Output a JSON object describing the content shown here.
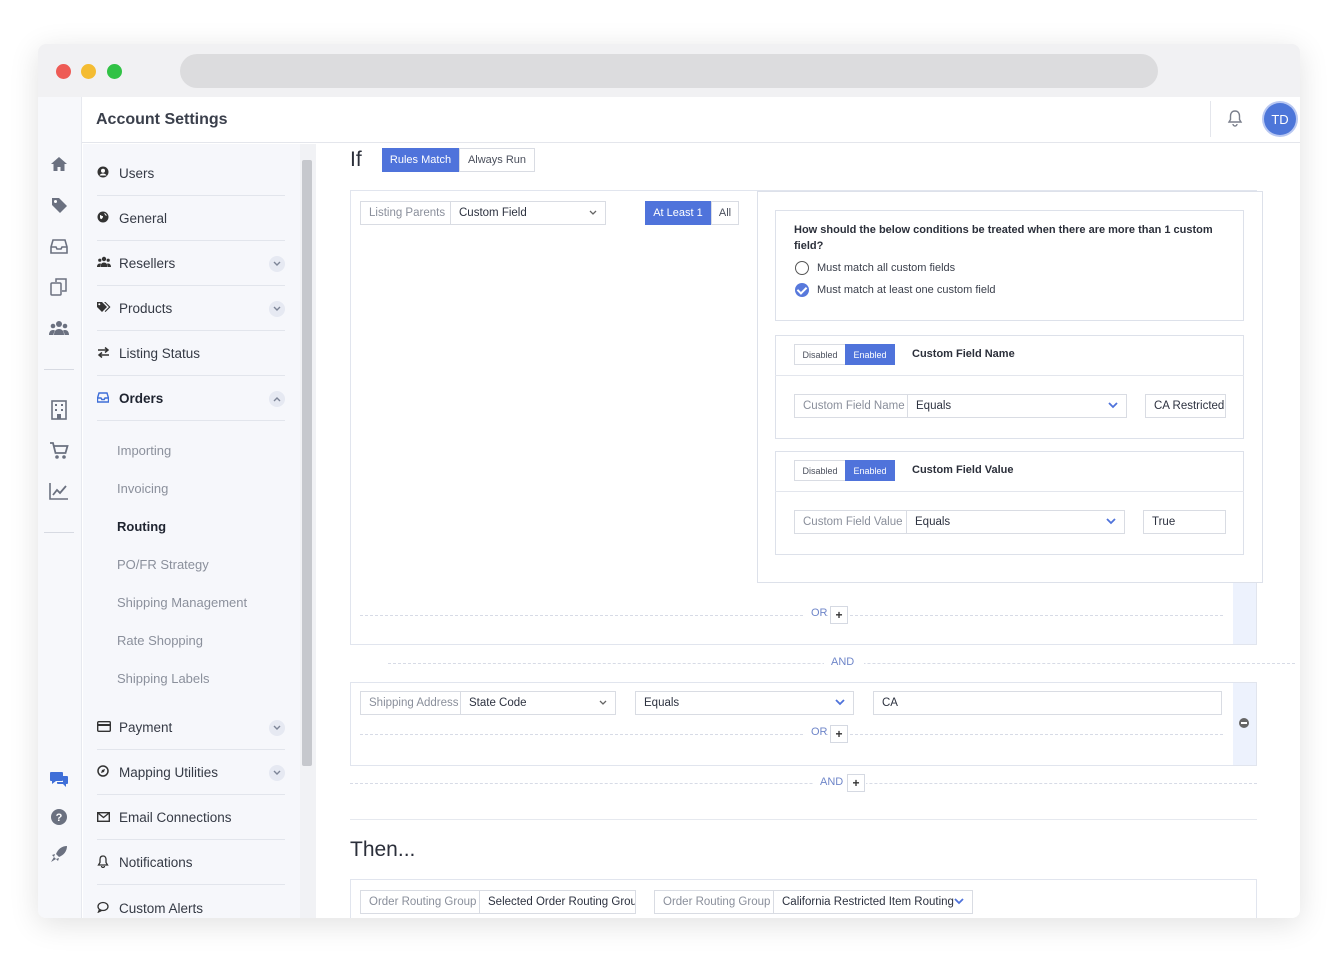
{
  "app": {
    "title": "Account Settings",
    "avatar_initials": "TD",
    "accent": "#4f73db"
  },
  "rail": {
    "icons": [
      "home-icon",
      "tag-icon",
      "inbox-icon",
      "copy-icon",
      "users-icon",
      "building-icon",
      "cart-icon",
      "chart-icon",
      "chat-icon",
      "help-icon",
      "rocket-icon",
      "gear-icon"
    ]
  },
  "nav": {
    "items": [
      {
        "label": "Users"
      },
      {
        "label": "General"
      },
      {
        "label": "Resellers"
      },
      {
        "label": "Products"
      },
      {
        "label": "Listing Status"
      },
      {
        "label": "Orders"
      },
      {
        "label": "Payment"
      },
      {
        "label": "Mapping Utilities"
      },
      {
        "label": "Email Connections"
      },
      {
        "label": "Notifications"
      },
      {
        "label": "Custom Alerts"
      }
    ],
    "orders_sub": [
      "Importing",
      "Invoicing",
      "Routing",
      "PO/FR Strategy",
      "Shipping Management",
      "Rate Shopping",
      "Shipping Labels"
    ]
  },
  "rule": {
    "if_label": "If",
    "mode_on": "Rules Match",
    "mode_off": "Always Run",
    "cond1": {
      "label": "Listing Parents",
      "field": "Custom Field",
      "match_on": "At Least 1",
      "match_off": "All"
    },
    "custom": {
      "question": "How should the below conditions be treated when there are more than 1 custom field?",
      "opt_all": "Must match all custom fields",
      "opt_one": "Must match at least one custom field",
      "name_block": {
        "disabled": "Disabled",
        "enabled": "Enabled",
        "title": "Custom Field Name",
        "label": "Custom Field Name",
        "op": "Equals",
        "value": "CA Restricted"
      },
      "value_block": {
        "disabled": "Disabled",
        "enabled": "Enabled",
        "title": "Custom Field Value",
        "label": "Custom Field Value",
        "op": "Equals",
        "value": "True"
      }
    },
    "or": "OR",
    "and": "AND",
    "cond2": {
      "label": "Shipping Address",
      "field": "State Code",
      "op": "Equals",
      "value": "CA"
    },
    "plus": "+",
    "then_label": "Then...",
    "action": {
      "label1": "Order Routing Group",
      "value1": "Selected Order Routing Grou",
      "label2": "Order Routing Group",
      "value2": "California Restricted Item Routing"
    }
  }
}
